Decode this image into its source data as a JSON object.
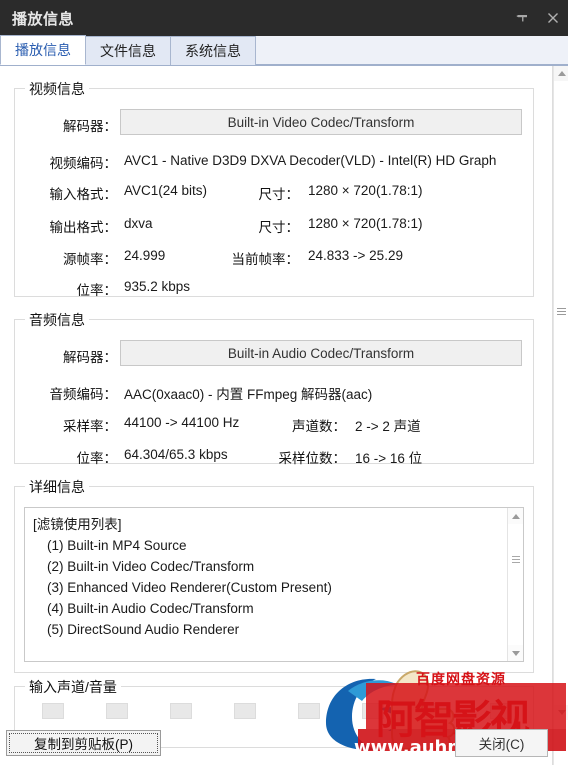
{
  "window": {
    "title": "播放信息",
    "pin_icon": "pin-icon",
    "close_icon": "close-icon"
  },
  "tabs": [
    {
      "label": "播放信息",
      "active": true
    },
    {
      "label": "文件信息",
      "active": false
    },
    {
      "label": "系统信息",
      "active": false
    }
  ],
  "video_group": {
    "legend": "视频信息",
    "decoder_label": "解码器：",
    "decoder_value": "Built-in Video Codec/Transform",
    "codec_label": "视频编码：",
    "codec_value": "AVC1 - Native D3D9 DXVA Decoder(VLD) - Intel(R) HD Graph",
    "input_format_label": "输入格式：",
    "input_format_value": "AVC1(24 bits)",
    "input_size_label": "尺寸：",
    "input_size_value": "1280 × 720(1.78:1)",
    "output_format_label": "输出格式：",
    "output_format_value": "dxva",
    "output_size_label": "尺寸：",
    "output_size_value": "1280 × 720(1.78:1)",
    "source_fps_label": "源帧率：",
    "source_fps_value": "24.999",
    "current_fps_label": "当前帧率：",
    "current_fps_value": "24.833 -> 25.29",
    "bitrate_label": "位率：",
    "bitrate_value": "935.2 kbps"
  },
  "audio_group": {
    "legend": "音频信息",
    "decoder_label": "解码器：",
    "decoder_value": "Built-in Audio Codec/Transform",
    "codec_label": "音频编码：",
    "codec_value": "AAC(0xaac0) - 内置 FFmpeg 解码器(aac)",
    "samplerate_label": "采样率：",
    "samplerate_value": "44100 -> 44100 Hz",
    "channels_label": "声道数：",
    "channels_value": "2 -> 2 声道",
    "bitrate_label": "位率：",
    "bitrate_value": "64.304/65.3 kbps",
    "bitdepth_label": "采样位数：",
    "bitdepth_value": "16 -> 16 位"
  },
  "detail_group": {
    "legend": "详细信息",
    "lines": [
      {
        "text": "[滤镜使用列表]",
        "indent": false
      },
      {
        "text": "(1) Built-in MP4 Source",
        "indent": true
      },
      {
        "text": "(2) Built-in Video Codec/Transform",
        "indent": true
      },
      {
        "text": "(3) Enhanced Video Renderer(Custom Present)",
        "indent": true
      },
      {
        "text": "(4) Built-in Audio Codec/Transform",
        "indent": true
      },
      {
        "text": "(5) DirectSound Audio Renderer",
        "indent": true
      }
    ]
  },
  "volume_group": {
    "legend": "输入声道/音量",
    "segments": 8
  },
  "buttons": {
    "copy": "复制到剪贴板(P)",
    "copy_key": "P",
    "close": "关闭(C)",
    "close_key": "C"
  },
  "watermark": {
    "top_text": "百度网盘资源",
    "main_text": "阿智影视",
    "url_text": "www.auhmm.com",
    "red": "#d61318",
    "blue": "#1463b0"
  }
}
